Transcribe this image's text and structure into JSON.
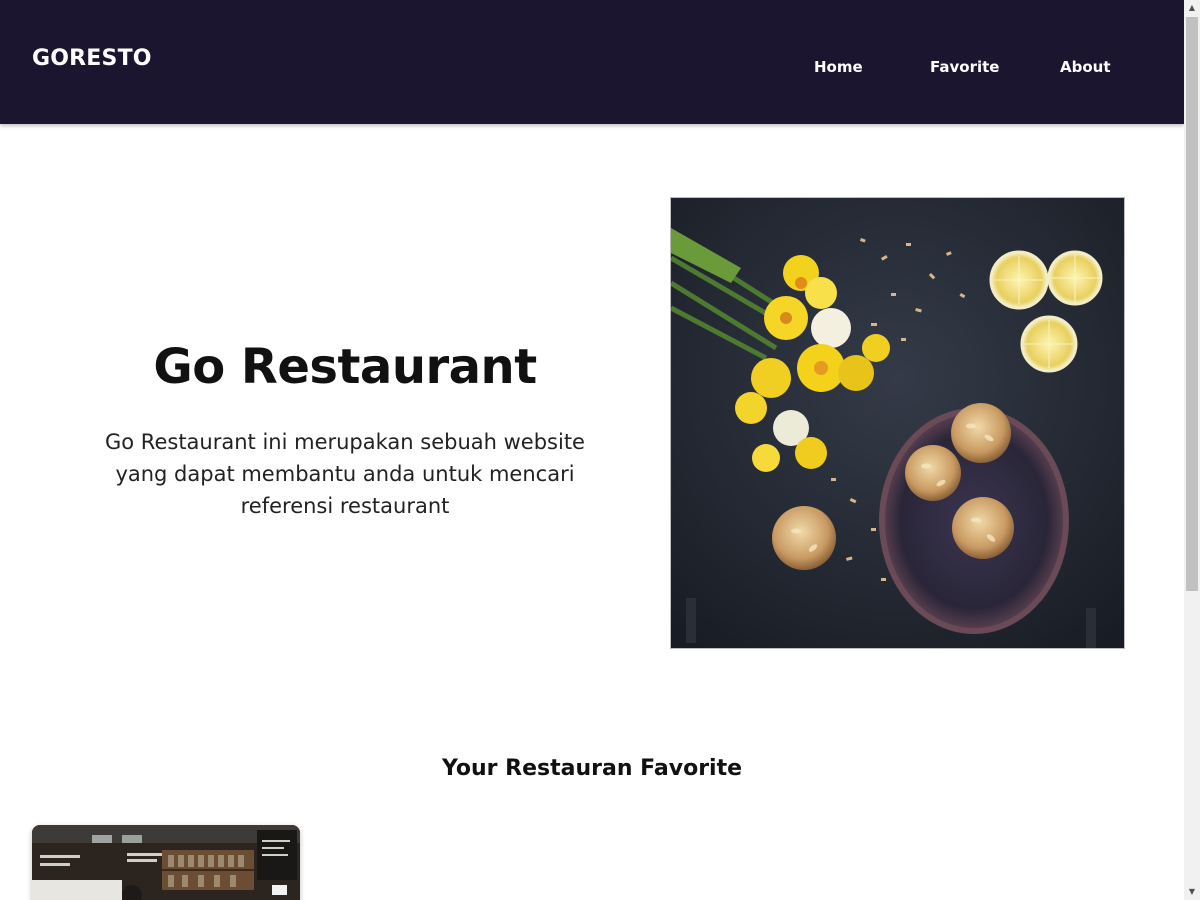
{
  "header": {
    "brand": "GORESTO",
    "nav": [
      {
        "label": "Home"
      },
      {
        "label": "Favorite"
      },
      {
        "label": "About"
      }
    ],
    "background_color": "#1c1530"
  },
  "hero": {
    "title": "Go Restaurant",
    "description": "Go Restaurant ini merupakan sebuah website yang dapat membantu anda untuk mencari referensi restaurant"
  },
  "favorites": {
    "title": "Your Restauran Favorite"
  }
}
